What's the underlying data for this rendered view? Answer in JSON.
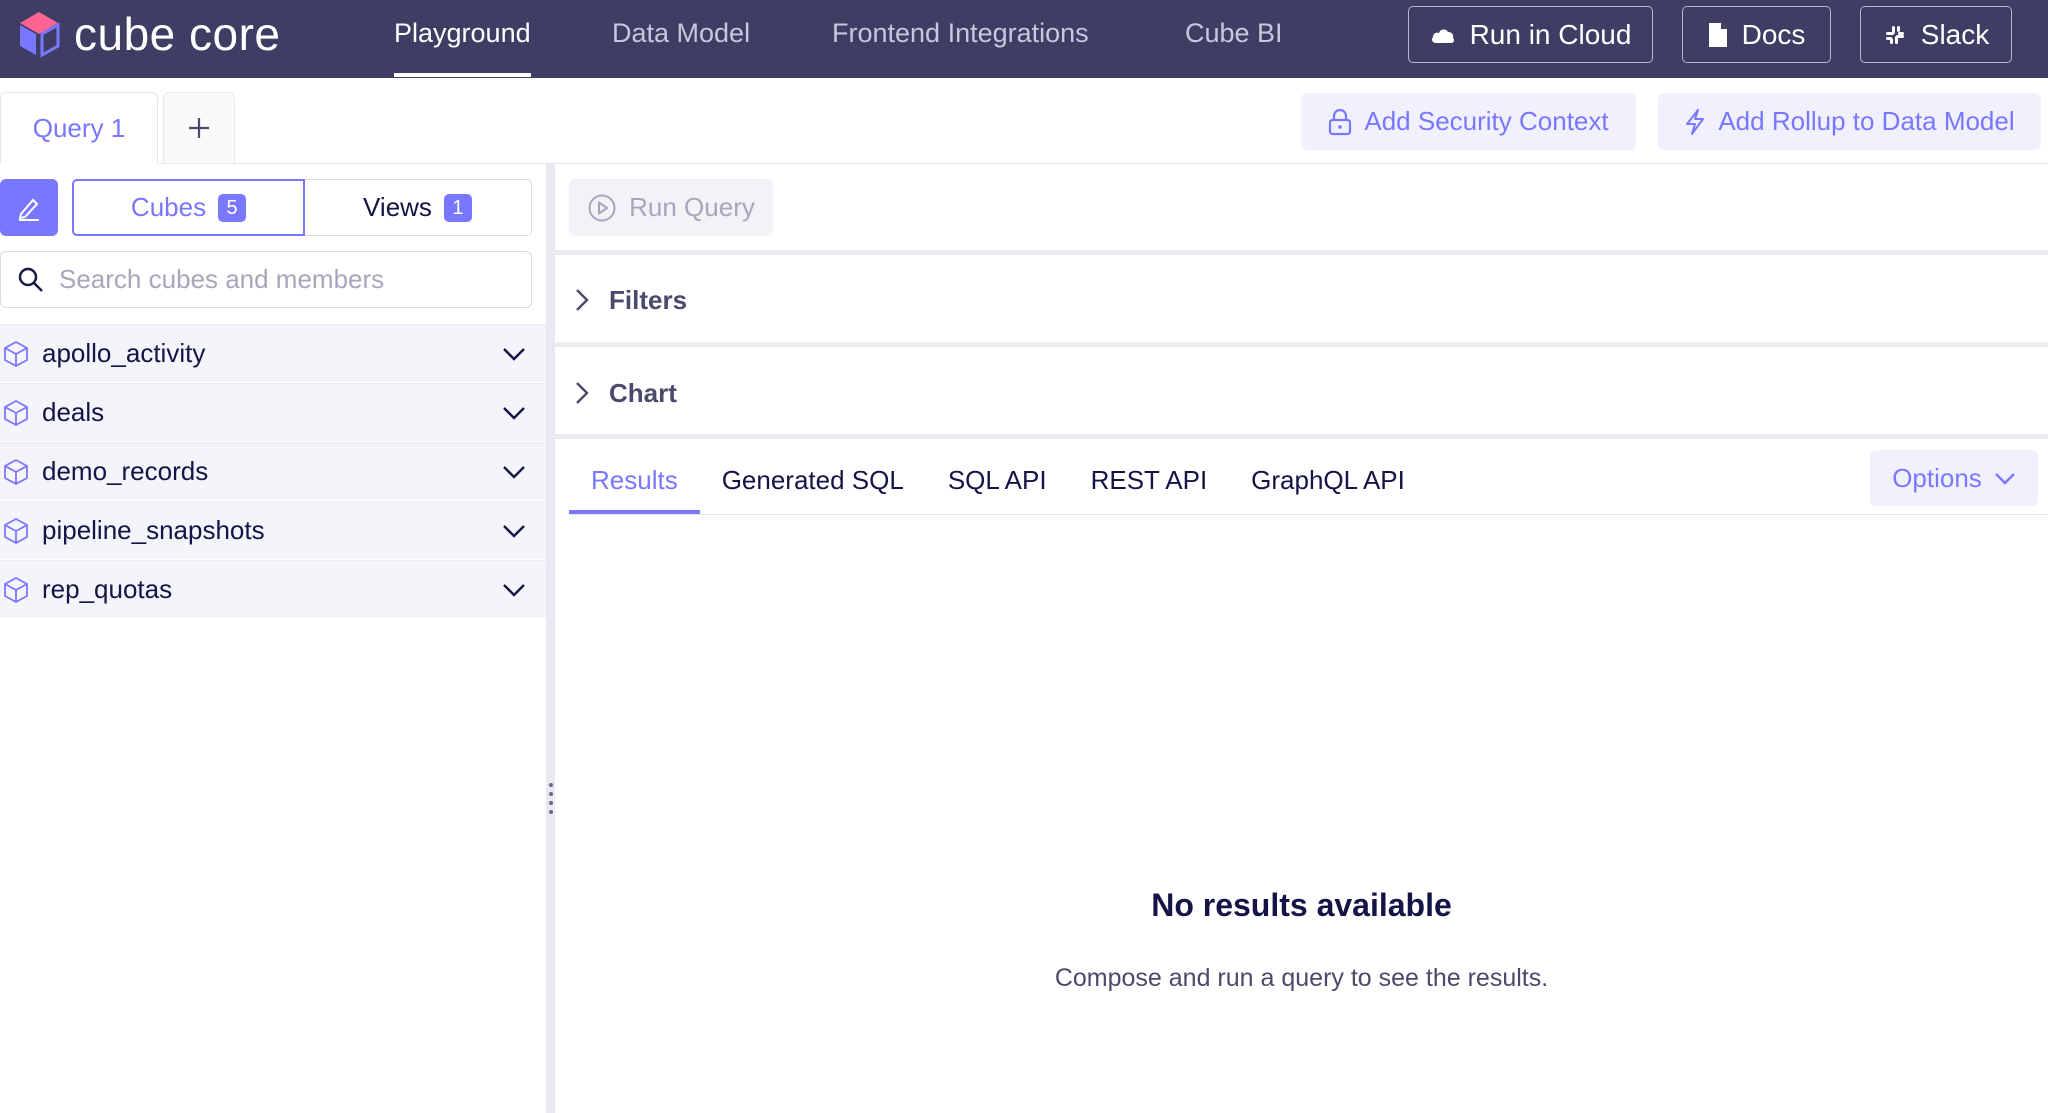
{
  "app": {
    "logo_text": "cube core",
    "nav": [
      "Playground",
      "Data Model",
      "Frontend Integrations",
      "Cube BI"
    ],
    "buttons": {
      "cloud": "Run in Cloud",
      "docs": "Docs",
      "slack": "Slack"
    }
  },
  "tabs": {
    "query_tab": "Query 1",
    "add_tab_icon": "plus-icon",
    "security_context": "Add Security Context",
    "rollup": "Add Rollup to Data Model"
  },
  "sidebar": {
    "segments": {
      "cubes_label": "Cubes",
      "cubes_count": "5",
      "views_label": "Views",
      "views_count": "1"
    },
    "search_placeholder": "Search cubes and members",
    "cubes": [
      "apollo_activity",
      "deals",
      "demo_records",
      "pipeline_snapshots",
      "rep_quotas"
    ]
  },
  "main": {
    "run_query": "Run Query",
    "filters": "Filters",
    "chart": "Chart",
    "result_tabs": [
      "Results",
      "Generated SQL",
      "SQL API",
      "REST API",
      "GraphQL API"
    ],
    "options": "Options",
    "empty_title": "No results available",
    "empty_subtitle": "Compose and run a query to see the results."
  },
  "colors": {
    "header_bg": "#3e3d63",
    "accent": "#7a77ff",
    "ink": "#141446",
    "soft_accent_bg": "#f1f1fe"
  }
}
